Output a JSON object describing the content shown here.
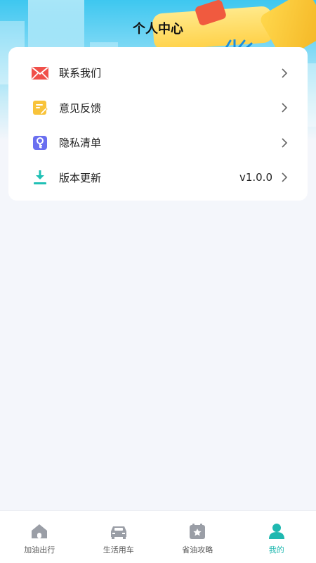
{
  "header": {
    "title": "个人中心"
  },
  "menu": {
    "items": [
      {
        "label": "联系我们",
        "icon": "mail-icon",
        "value": ""
      },
      {
        "label": "意见反馈",
        "icon": "feedback-icon",
        "value": ""
      },
      {
        "label": "隐私清单",
        "icon": "privacy-icon",
        "value": ""
      },
      {
        "label": "版本更新",
        "icon": "download-icon",
        "value": "v1.0.0"
      }
    ]
  },
  "tabbar": {
    "tabs": [
      {
        "label": "加油出行",
        "icon": "home-icon",
        "active": false
      },
      {
        "label": "生活用车",
        "icon": "car-icon",
        "active": false
      },
      {
        "label": "省油攻略",
        "icon": "guide-icon",
        "active": false
      },
      {
        "label": "我的",
        "icon": "user-icon",
        "active": true
      }
    ]
  },
  "colors": {
    "accent": "#1fb8b0",
    "mail": "#f0504a",
    "feedback": "#f8c33a",
    "privacy": "#6a6ff0",
    "download": "#20c0b5"
  }
}
